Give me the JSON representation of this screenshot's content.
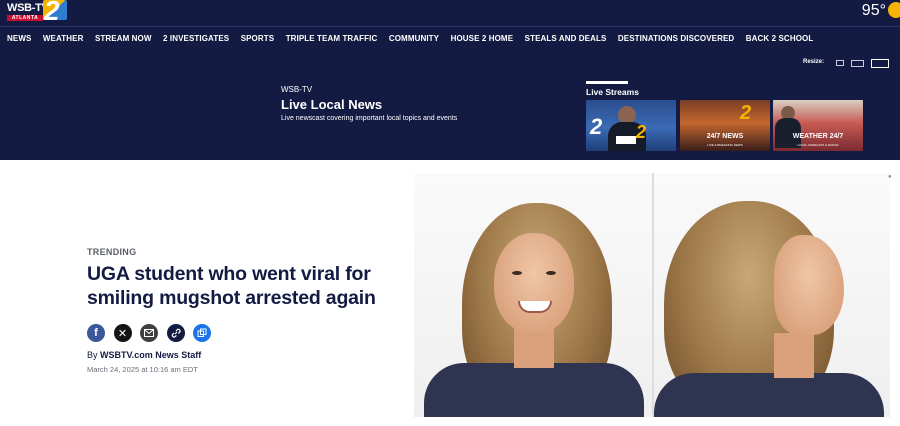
{
  "header": {
    "logo_text": "WSB-TV",
    "logo_subtext": "ATLANTA",
    "logo_channel": "2",
    "temperature": "95°"
  },
  "nav": {
    "items": [
      "NEWS",
      "WEATHER",
      "STREAM NOW",
      "2 INVESTIGATES",
      "SPORTS",
      "TRIPLE TEAM TRAFFIC",
      "COMMUNITY",
      "HOUSE 2 HOME",
      "STEALS AND DEALS",
      "DESTINATIONS DISCOVERED",
      "BACK 2 SCHOOL"
    ]
  },
  "promo": {
    "resize_label": "Resize:",
    "brand": "WSB-TV",
    "title": "Live Local News",
    "description": "Live newscast covering important local topics and events",
    "live_streams_label": "Live Streams",
    "streams": [
      {
        "label": ""
      },
      {
        "label": "24/7 NEWS",
        "sub": "LIVE & BREAKING NEWS"
      },
      {
        "label": "WEATHER 24/7",
        "sub": "LOCAL FORECAST & RADAR"
      }
    ]
  },
  "article": {
    "kicker": "TRENDING",
    "headline": "UGA student who went viral for smiling mugshot arrested again",
    "byline_prefix": "By ",
    "byline_author": "WSBTV.com News Staff",
    "date": "March 24, 2025 at 10:16 am EDT"
  },
  "colors": {
    "header_bg": "#141b43",
    "facebook": "#3b5998",
    "copy_link": "#1a73e8",
    "accent_yellow": "#f6b400"
  }
}
